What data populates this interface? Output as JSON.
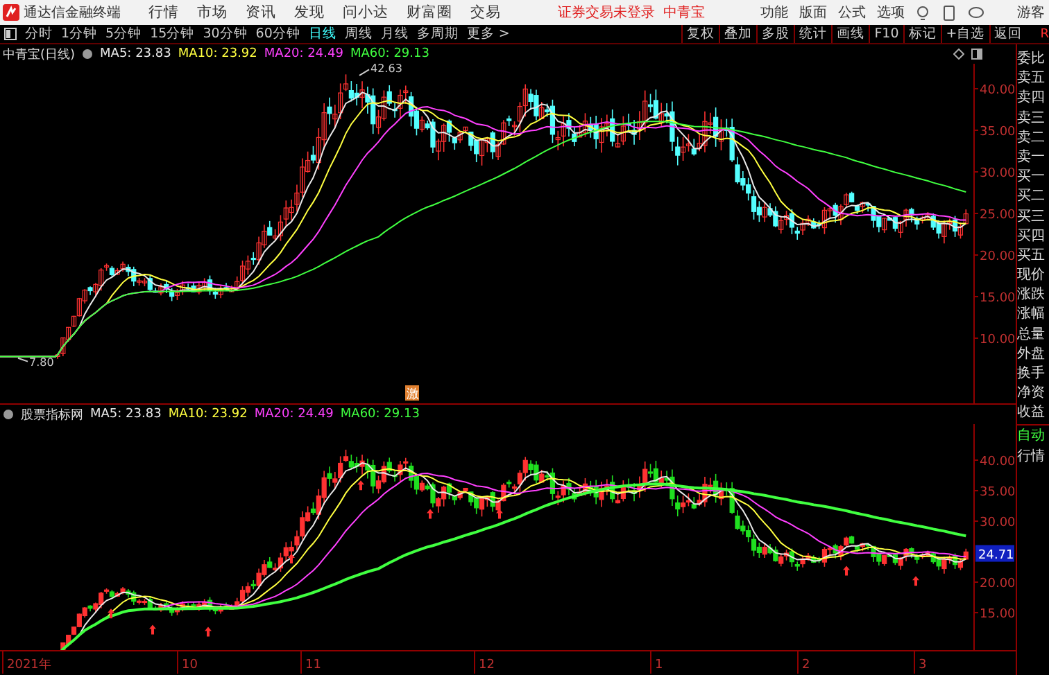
{
  "app": {
    "title": "通达信金融终端",
    "menu": [
      "行情",
      "市场",
      "资讯",
      "发现",
      "问小达",
      "财富圈",
      "交易"
    ],
    "notice": "证券交易未登录",
    "stock_link": "中青宝",
    "tools": [
      "功能",
      "版面",
      "公式",
      "选项"
    ],
    "user": "游客"
  },
  "period_tabs": [
    {
      "label": "分时",
      "selected": false
    },
    {
      "label": "1分钟",
      "selected": false
    },
    {
      "label": "5分钟",
      "selected": false
    },
    {
      "label": "15分钟",
      "selected": false
    },
    {
      "label": "30分钟",
      "selected": false
    },
    {
      "label": "60分钟",
      "selected": false
    },
    {
      "label": "日线",
      "selected": true
    },
    {
      "label": "周线",
      "selected": false
    },
    {
      "label": "月线",
      "selected": false
    },
    {
      "label": "多周期",
      "selected": false
    },
    {
      "label": "更多 >",
      "selected": false
    }
  ],
  "actions": [
    "复权",
    "叠加",
    "多股",
    "统计",
    "画线",
    "F10",
    "标记",
    "+自选",
    "返回"
  ],
  "corner_label": "R",
  "main_chart": {
    "title": "中青宝(日线)",
    "ma": [
      {
        "label": "MA5: 23.83",
        "color": "#e8e8e8"
      },
      {
        "label": "MA10: 23.92",
        "color": "#ffff40"
      },
      {
        "label": "MA20: 24.49",
        "color": "#ff40ff"
      },
      {
        "label": "MA60: 29.13",
        "color": "#40ff40"
      }
    ],
    "high_label": "42.63",
    "low_label": "7.80",
    "badge": "激",
    "price_labels": [
      "40.00",
      "35.00",
      "30.00",
      "25.00",
      "20.00",
      "15.00",
      "10.00"
    ]
  },
  "indicator_chart": {
    "title": "股票指标网",
    "ma": [
      {
        "label": "MA5: 23.83",
        "color": "#e8e8e8"
      },
      {
        "label": "MA10: 23.92",
        "color": "#ffff40"
      },
      {
        "label": "MA20: 24.49",
        "color": "#ff40ff"
      },
      {
        "label": "MA60: 29.13",
        "color": "#40ff40"
      }
    ],
    "price_labels": [
      "40.00",
      "35.00",
      "30.00",
      "20.00",
      "15.00"
    ],
    "current_price": "24.71"
  },
  "x_axis": [
    "2021年",
    "10",
    "11",
    "12",
    "1",
    "2",
    "3"
  ],
  "quote_fields": [
    "委比",
    "卖五",
    "卖四",
    "卖三",
    "卖二",
    "卖一",
    "买一",
    "买二",
    "买三",
    "买四",
    "买五",
    "现价",
    "涨跌",
    "涨幅",
    "总量",
    "外盘",
    "换手",
    "净资",
    "收益"
  ],
  "side_buttons": [
    "自动",
    "行情"
  ]
}
